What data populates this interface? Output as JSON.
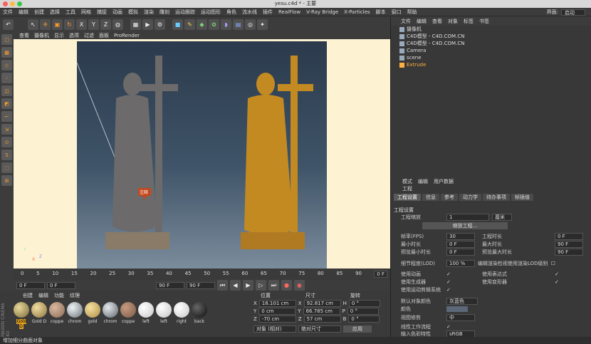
{
  "window": {
    "title": "yesu.c4d * - 主要"
  },
  "menu": {
    "items": [
      "文件",
      "编辑",
      "创建",
      "选择",
      "工具",
      "网格",
      "捕捉",
      "动画",
      "模拟",
      "渲染",
      "雕刻",
      "运动跟踪",
      "运动图形",
      "角色",
      "流水线",
      "插件",
      "RealFlow",
      "V-Ray Bridge",
      "X-Particles",
      "脚本",
      "窗口",
      "帮助"
    ],
    "interface_label": "界面:",
    "interface_value": "启动"
  },
  "toolbar": {
    "icons": [
      "undo-icon",
      "select-icon",
      "move-icon",
      "scale-icon",
      "rotate-icon",
      "axis-x-icon",
      "axis-y-icon",
      "axis-z-icon",
      "world-icon",
      "render-region-icon",
      "render-view-icon",
      "render-settings-icon",
      "cube-icon",
      "pen-icon",
      "subdivide-icon",
      "array-icon",
      "deformer-icon",
      "floor-icon",
      "camera-icon",
      "light-icon"
    ],
    "axis_labels": [
      "X",
      "Y",
      "Z"
    ]
  },
  "viewport": {
    "menu": [
      "查看",
      "摄像机",
      "显示",
      "选项",
      "过滤",
      "面板",
      "ProRender"
    ],
    "annotation": "注释",
    "axis": {
      "x": "X",
      "y": "Y",
      "z": "Z"
    }
  },
  "timeline": {
    "ticks": [
      "0",
      "5",
      "10",
      "15",
      "20",
      "25",
      "30",
      "35",
      "40",
      "45",
      "50",
      "55",
      "60",
      "65",
      "70",
      "75",
      "80",
      "85",
      "90"
    ],
    "end_frame": "0 F",
    "start_field": "0 F",
    "current_field": "0 F",
    "end_field": "90 F",
    "max_field": "90 F"
  },
  "materials": {
    "menu": [
      "创建",
      "编辑",
      "功能",
      "纹理"
    ],
    "items": [
      {
        "label": "Gold D",
        "color": "#7a6a3a"
      },
      {
        "label": "Gold D",
        "color": "#8a7440"
      },
      {
        "label": "coppe",
        "color": "#8a6a52"
      },
      {
        "label": "chrom",
        "color": "#9aa4ac"
      },
      {
        "label": "gold",
        "color": "#b08c48"
      },
      {
        "label": "chrom",
        "color": "#8d959c"
      },
      {
        "label": "coppe",
        "color": "#7a5a46"
      },
      {
        "label": "left",
        "color": "#f4f4f4"
      },
      {
        "label": "left",
        "color": "#f0f0f0"
      },
      {
        "label": "right",
        "color": "#f2f2f2"
      },
      {
        "label": "back",
        "color": "#1a1a1a"
      }
    ]
  },
  "coordinates": {
    "headers": {
      "position": "位置",
      "size": "尺寸",
      "rotation": "旋转"
    },
    "rows": [
      {
        "axis": "X",
        "pos": "18.101 cm",
        "size_axis": "X",
        "size": "92.817 cm",
        "rot_axis": "H",
        "rot": "0 °"
      },
      {
        "axis": "Y",
        "pos": "0 cm",
        "size_axis": "Y",
        "size": "66.785 cm",
        "rot_axis": "P",
        "rot": "0 °"
      },
      {
        "axis": "Z",
        "pos": "-70 cm",
        "size_axis": "Z",
        "size": "57 cm",
        "rot_axis": "B",
        "rot": "0 °"
      }
    ],
    "mode_left": "对象 (相对)",
    "mode_right": "绝对尺寸",
    "apply": "应用"
  },
  "objects": {
    "menu": [
      "文件",
      "编辑",
      "查看",
      "对象",
      "标签",
      "书签"
    ],
    "rows": [
      {
        "name": "摄像机",
        "color": "#cfcfcf"
      },
      {
        "name": "C4D模型 - C4D.COM.CN",
        "color": "#cfcfcf"
      },
      {
        "name": "C4D模型 - C4D.COM.CN",
        "color": "#cfcfcf"
      },
      {
        "name": "Camera",
        "color": "#cfcfcf"
      },
      {
        "name": "scene",
        "color": "#cfcfcf"
      },
      {
        "name": "Extrude",
        "color": "#ffb040"
      }
    ]
  },
  "attributes": {
    "menu": [
      "模式",
      "编辑",
      "用户数据"
    ],
    "title": "工程",
    "tabs": [
      "工程设置",
      "信息",
      "参考",
      "动力学",
      "待办事项",
      "帧插值"
    ],
    "section": "工程设置",
    "fields": {
      "scale_label": "工程缩放",
      "scale_value": "1",
      "scale_unit": "厘米",
      "scale_button": "缩放工程...",
      "fps_label": "帧率(FPS)",
      "fps_value": "30",
      "duration_label": "工程时长",
      "duration_value": "0 F",
      "min_label": "最小时长",
      "min_value": "0 F",
      "max_label": "最大时长",
      "max_value": "90 F",
      "pmin_label": "预览最小时长",
      "pmin_value": "0 F",
      "pmax_label": "预览最大时长",
      "pmax_value": "90 F",
      "lod_label": "细节程度(LOD)",
      "lod_value": "100 %",
      "lod_render": "编辑渲染检视使用渲染LOD级别",
      "anim_label": "使用动画",
      "expr_label": "使用表达式",
      "gen_label": "使用生成器",
      "deform_label": "使用变形器",
      "mograph_label": "使用运动剪辑系统",
      "defcolor_label": "默认对象颜色",
      "defcolor_value": "灰蓝色",
      "color_label": "颜色",
      "clip_label": "视图修剪",
      "clip_value": "中",
      "linear_label": "线性工作流程",
      "input_label": "输入色彩特性",
      "input_value": "sRGB"
    }
  },
  "status": {
    "text": "增加细分曲面对象"
  },
  "maxon": {
    "text": "MAXON CINEMA 4D"
  }
}
